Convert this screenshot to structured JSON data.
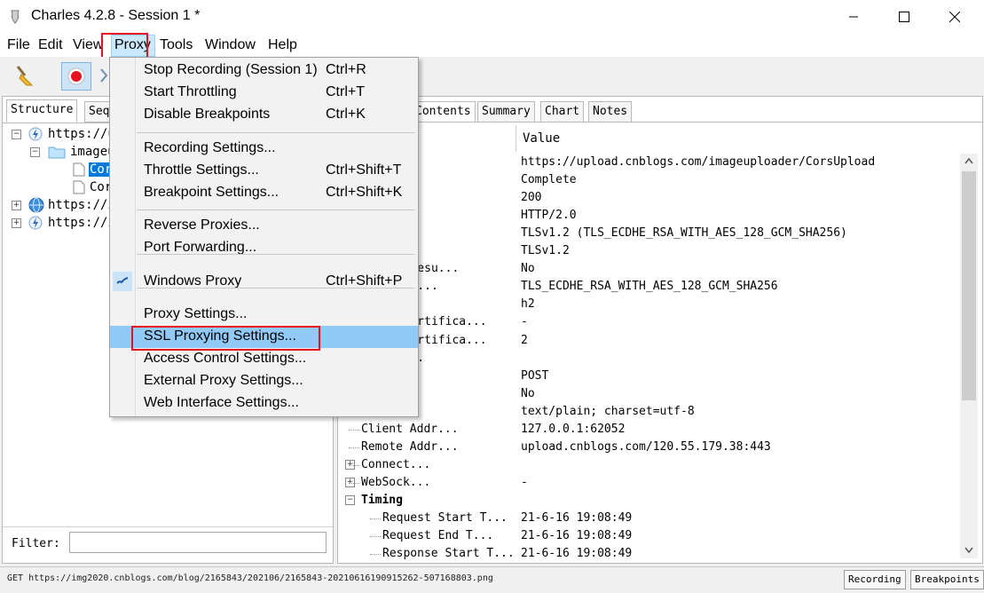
{
  "window": {
    "title": "Charles 4.2.8 - Session 1 *"
  },
  "menubar": {
    "file": "File",
    "edit": "Edit",
    "view": "View",
    "proxy": "Proxy",
    "tools": "Tools",
    "window": "Window",
    "help": "Help"
  },
  "left": {
    "tabs": [
      "Structure",
      "Seq"
    ],
    "tree": [
      "https://u",
      "imageu",
      "Cor",
      "Cor",
      "https://i",
      "https://i"
    ],
    "filter_label": "Filter:",
    "filter_value": ""
  },
  "right": {
    "tabs": [
      "Contents",
      "Summary",
      "Chart",
      "Notes"
    ],
    "value_header": "Value",
    "rows": [
      {
        "name": "",
        "value": "https://upload.cnblogs.com/imageuploader/CorsUpload"
      },
      {
        "name": "",
        "value": "Complete"
      },
      {
        "name": "C...",
        "value": "200"
      },
      {
        "name": "",
        "value": "HTTP/2.0"
      },
      {
        "name": "",
        "value": "TLSv1.2 (TLS_ECDHE_RSA_WITH_AES_128_GCM_SHA256)"
      },
      {
        "name": "col",
        "value": "TLSv1.2"
      },
      {
        "name": "on Resu...",
        "value": "No"
      },
      {
        "name": "r Su...",
        "value": "TLS_ECDHE_RSA_WITH_AES_128_GCM_SHA256"
      },
      {
        "name": "",
        "value": "h2"
      },
      {
        "name": "t Certifica...",
        "value": "-"
      },
      {
        "name": "r Certifica...",
        "value": "2"
      },
      {
        "name": "si...",
        "value": ""
      },
      {
        "name": "",
        "value": "POST"
      },
      {
        "name": "..",
        "value": "No"
      },
      {
        "name": "T...",
        "value": "text/plain; charset=utf-8"
      },
      {
        "name": "Client Addr...",
        "value": "127.0.0.1:62052"
      },
      {
        "name": "Remote Addr...",
        "value": "upload.cnblogs.com/120.55.179.38:443"
      },
      {
        "name": "Connect...",
        "value": ""
      },
      {
        "name": "WebSock...",
        "value": "-"
      },
      {
        "name": "Timing",
        "value": ""
      },
      {
        "name": "Request Start T...",
        "value": "21-6-16 19:08:49"
      },
      {
        "name": "Request End T...",
        "value": "21-6-16 19:08:49"
      },
      {
        "name": "Response Start T...",
        "value": "21-6-16 19:08:49"
      }
    ]
  },
  "proxy_menu": {
    "items": [
      {
        "label": "Stop Recording (Session 1)",
        "shortcut": "Ctrl+R"
      },
      {
        "label": "Start Throttling",
        "shortcut": "Ctrl+T"
      },
      {
        "label": "Disable Breakpoints",
        "shortcut": "Ctrl+K"
      },
      {
        "label": "Recording Settings...",
        "shortcut": ""
      },
      {
        "label": "Throttle Settings...",
        "shortcut": "Ctrl+Shift+T"
      },
      {
        "label": "Breakpoint Settings...",
        "shortcut": "Ctrl+Shift+K"
      },
      {
        "label": "Reverse Proxies...",
        "shortcut": ""
      },
      {
        "label": "Port Forwarding...",
        "shortcut": ""
      },
      {
        "label": "Windows Proxy",
        "shortcut": "Ctrl+Shift+P"
      },
      {
        "label": "Proxy Settings...",
        "shortcut": ""
      },
      {
        "label": "SSL Proxying Settings...",
        "shortcut": ""
      },
      {
        "label": "Access Control Settings...",
        "shortcut": ""
      },
      {
        "label": "External Proxy Settings...",
        "shortcut": ""
      },
      {
        "label": "Web Interface Settings...",
        "shortcut": ""
      }
    ]
  },
  "status": {
    "text": "GET https://img2020.cnblogs.com/blog/2165843/202106/2165843-20210616190915262-507168803.png",
    "recording": "Recording",
    "breakpoints": "Breakpoints"
  },
  "colors": {
    "highlight_box": "#e81123",
    "menu_hover": "#91c9f7",
    "selection": "#0078d7"
  }
}
